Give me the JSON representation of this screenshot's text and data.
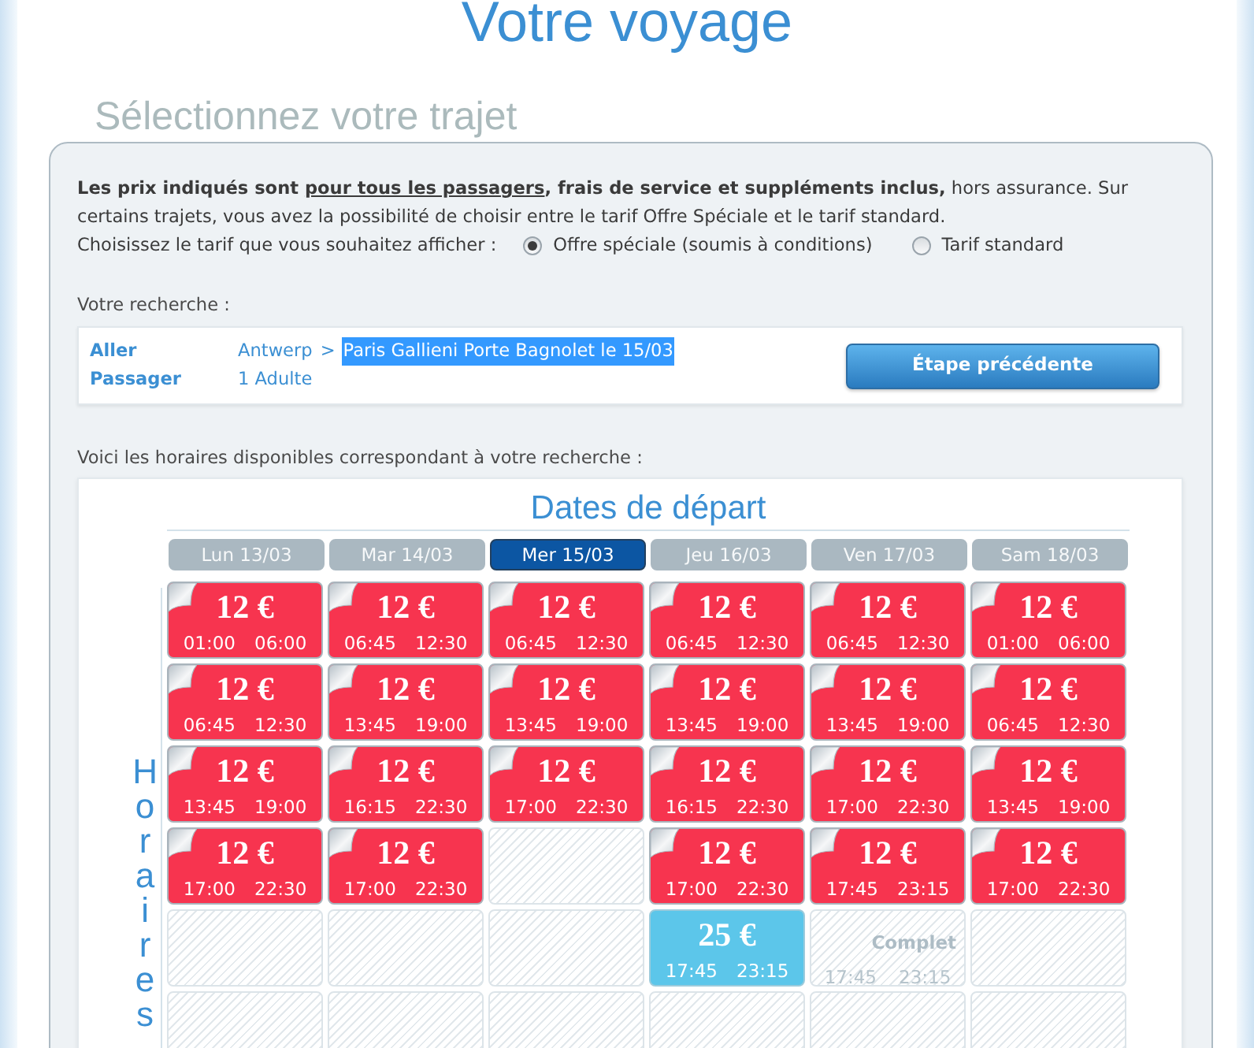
{
  "page": {
    "title": "Votre voyage",
    "subtitle": "Sélectionnez votre trajet"
  },
  "notice": {
    "segments": [
      {
        "text": "Les prix indiqués sont ",
        "bold": true,
        "underline": false
      },
      {
        "text": "pour tous les passagers",
        "bold": true,
        "underline": true
      },
      {
        "text": ", frais de service et suppléments inclus,",
        "bold": true,
        "underline": false
      },
      {
        "text": " hors assurance. Sur certains trajets, vous avez la possibilité de choisir entre le tarif Offre Spéciale et le tarif standard.",
        "bold": false,
        "underline": false
      }
    ]
  },
  "fare_choice": {
    "prompt": "Choisissez le tarif que vous souhaitez afficher :",
    "options": [
      {
        "label": "Offre spéciale (soumis à conditions)",
        "selected": true
      },
      {
        "label": "Tarif standard",
        "selected": false
      }
    ]
  },
  "search": {
    "heading": "Votre recherche :",
    "route": {
      "label": "Aller",
      "origin": "Antwerp",
      "separator": ">",
      "destination": "Paris Gallieni Porte Bagnolet le 15/03",
      "highlighted": true
    },
    "passengers": {
      "label": "Passager",
      "value": "1 Adulte"
    },
    "back_button": "Étape précédente"
  },
  "timetable": {
    "intro": "Voici les horaires disponibles correspondant à votre recherche :",
    "title": "Dates de départ",
    "side_label": "Horaires",
    "days": [
      {
        "label": "Lun 13/03",
        "selected": false
      },
      {
        "label": "Mar 14/03",
        "selected": false
      },
      {
        "label": "Mer 15/03",
        "selected": true
      },
      {
        "label": "Jeu 16/03",
        "selected": false
      },
      {
        "label": "Ven 17/03",
        "selected": false
      },
      {
        "label": "Sam 18/03",
        "selected": false
      }
    ],
    "rows": [
      {
        "cells": [
          {
            "kind": "offer",
            "price": "12 €",
            "departure": "01:00",
            "arrival": "06:00"
          },
          {
            "kind": "offer",
            "price": "12 €",
            "departure": "06:45",
            "arrival": "12:30"
          },
          {
            "kind": "offer",
            "price": "12 €",
            "departure": "06:45",
            "arrival": "12:30"
          },
          {
            "kind": "offer",
            "price": "12 €",
            "departure": "06:45",
            "arrival": "12:30"
          },
          {
            "kind": "offer",
            "price": "12 €",
            "departure": "06:45",
            "arrival": "12:30"
          },
          {
            "kind": "offer",
            "price": "12 €",
            "departure": "01:00",
            "arrival": "06:00"
          }
        ]
      },
      {
        "cells": [
          {
            "kind": "offer",
            "price": "12 €",
            "departure": "06:45",
            "arrival": "12:30"
          },
          {
            "kind": "offer",
            "price": "12 €",
            "departure": "13:45",
            "arrival": "19:00"
          },
          {
            "kind": "offer",
            "price": "12 €",
            "departure": "13:45",
            "arrival": "19:00"
          },
          {
            "kind": "offer",
            "price": "12 €",
            "departure": "13:45",
            "arrival": "19:00"
          },
          {
            "kind": "offer",
            "price": "12 €",
            "departure": "13:45",
            "arrival": "19:00"
          },
          {
            "kind": "offer",
            "price": "12 €",
            "departure": "06:45",
            "arrival": "12:30"
          }
        ]
      },
      {
        "cells": [
          {
            "kind": "offer",
            "price": "12 €",
            "departure": "13:45",
            "arrival": "19:00"
          },
          {
            "kind": "offer",
            "price": "12 €",
            "departure": "16:15",
            "arrival": "22:30"
          },
          {
            "kind": "offer",
            "price": "12 €",
            "departure": "17:00",
            "arrival": "22:30"
          },
          {
            "kind": "offer",
            "price": "12 €",
            "departure": "16:15",
            "arrival": "22:30"
          },
          {
            "kind": "offer",
            "price": "12 €",
            "departure": "17:00",
            "arrival": "22:30"
          },
          {
            "kind": "offer",
            "price": "12 €",
            "departure": "13:45",
            "arrival": "19:00"
          }
        ]
      },
      {
        "cells": [
          {
            "kind": "offer",
            "price": "12 €",
            "departure": "17:00",
            "arrival": "22:30"
          },
          {
            "kind": "offer",
            "price": "12 €",
            "departure": "17:00",
            "arrival": "22:30"
          },
          {
            "kind": "empty"
          },
          {
            "kind": "offer",
            "price": "12 €",
            "departure": "17:00",
            "arrival": "22:30"
          },
          {
            "kind": "offer",
            "price": "12 €",
            "departure": "17:45",
            "arrival": "23:15"
          },
          {
            "kind": "offer",
            "price": "12 €",
            "departure": "17:00",
            "arrival": "22:30"
          }
        ]
      },
      {
        "cells": [
          {
            "kind": "empty"
          },
          {
            "kind": "empty"
          },
          {
            "kind": "empty"
          },
          {
            "kind": "standard",
            "price": "25 €",
            "departure": "17:45",
            "arrival": "23:15"
          },
          {
            "kind": "full",
            "status": "Complet",
            "departure": "17:45",
            "arrival": "23:15"
          },
          {
            "kind": "empty"
          }
        ]
      },
      {
        "cells": [
          {
            "kind": "empty"
          },
          {
            "kind": "empty"
          },
          {
            "kind": "empty"
          },
          {
            "kind": "empty"
          },
          {
            "kind": "empty"
          },
          {
            "kind": "empty"
          }
        ]
      }
    ]
  }
}
